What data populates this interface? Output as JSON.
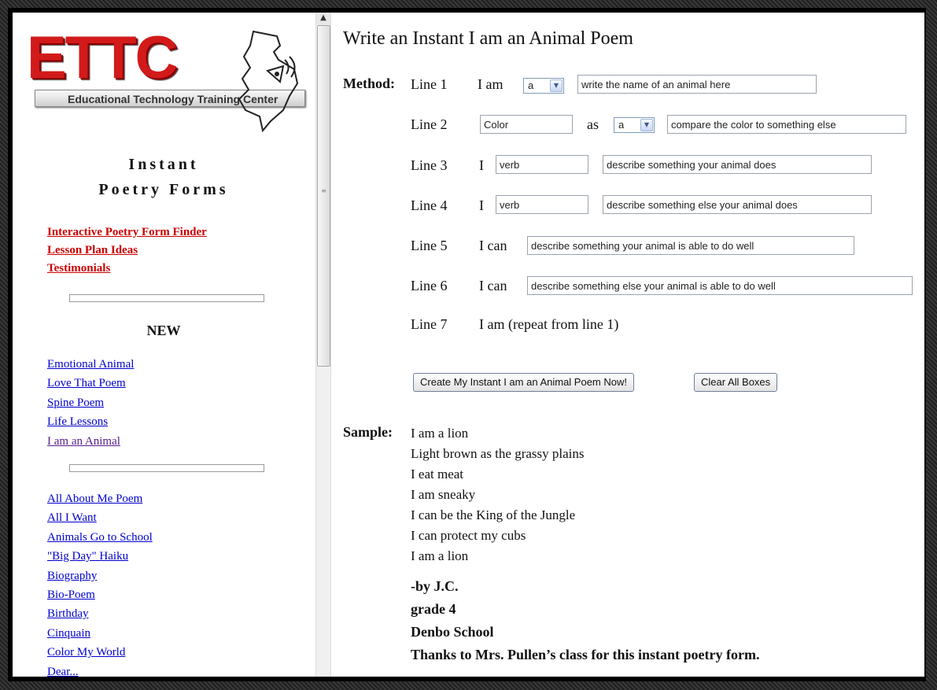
{
  "sidebar": {
    "logo": {
      "wordmark": "ETTC",
      "subtitle": "Educational Technology Training Center"
    },
    "title_line1": "Instant",
    "title_line2": "Poetry Forms",
    "red_links": [
      "Interactive Poetry Form Finder",
      "Lesson Plan Ideas",
      "Testimonials"
    ],
    "new_heading": "NEW",
    "new_links": [
      "Emotional Animal",
      "Love That Poem",
      "Spine Poem",
      "Life Lessons",
      "I am an Animal"
    ],
    "all_links": [
      "All About Me Poem",
      "All I Want",
      "Animals Go to School",
      "\"Big Day\" Haiku",
      "Biography",
      "Bio-Poem",
      "Birthday",
      "Cinquain",
      "Color My World",
      "Dear..."
    ]
  },
  "scrollbar": {
    "up_arrow": "▲",
    "grip": "≡"
  },
  "main": {
    "title": "Write an Instant I am an Animal Poem",
    "method_label": "Method:",
    "lines": {
      "l1": {
        "label": "Line 1",
        "word": "I am",
        "select": "a",
        "input": "write the name of an animal here"
      },
      "l2": {
        "label": "Line 2",
        "input_color": "Color",
        "word": "as",
        "select": "a",
        "input": "compare the color to something else"
      },
      "l3": {
        "label": "Line 3",
        "word": "I",
        "input_verb": "verb",
        "input": "describe something your animal does"
      },
      "l4": {
        "label": "Line 4",
        "word": "I",
        "input_verb": "verb",
        "input": "describe something else your animal does"
      },
      "l5": {
        "label": "Line 5",
        "word": "I can",
        "input": "describe something your animal is able to do well"
      },
      "l6": {
        "label": "Line 6",
        "word": "I can",
        "input": "describe something else your animal is able to do well"
      },
      "l7": {
        "label": "Line 7",
        "text": "I am (repeat from line 1)"
      }
    },
    "create_button": "Create My Instant  I am an Animal Poem Now!",
    "clear_button": "Clear All Boxes",
    "sample_label": "Sample:",
    "sample_lines": [
      "I am a lion",
      "Light brown as the grassy plains",
      "I eat meat",
      "I am sneaky",
      "I can be the King of the Jungle",
      "I can protect my cubs",
      "I am a lion"
    ],
    "credits": [
      "-by J.C.",
      "grade 4",
      "Denbo School",
      "Thanks to Mrs. Pullen’s class for this instant poetry form."
    ]
  },
  "colors": {
    "logo_red": "#d21a1a",
    "link_red": "#cc0000",
    "link_blue": "#0000cc",
    "link_visited": "#551a8b"
  }
}
